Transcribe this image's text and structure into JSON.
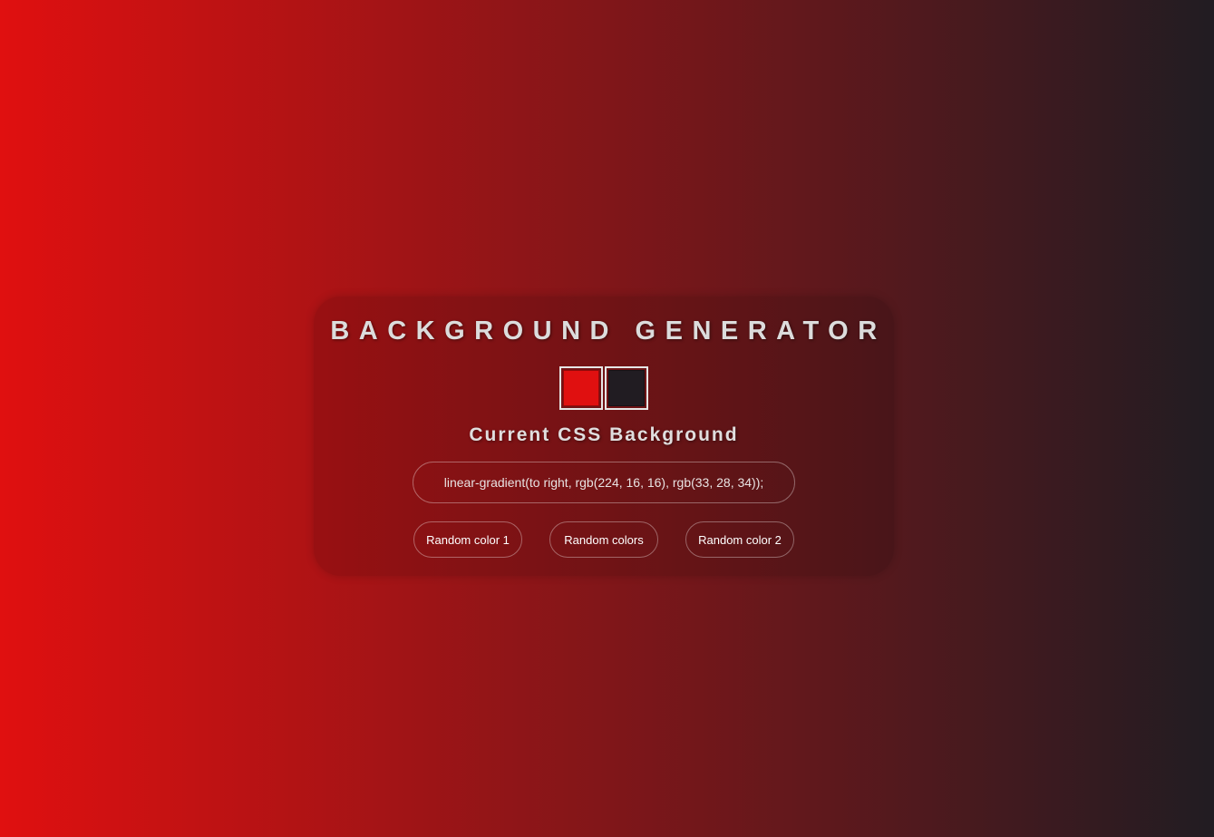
{
  "app": {
    "title": "BACKGROUND GENERATOR"
  },
  "colors": {
    "color1": "#e01010",
    "color2": "#211c22"
  },
  "current": {
    "label": "Current CSS Background",
    "value": "linear-gradient(to right, rgb(224, 16, 16), rgb(33, 28, 34));"
  },
  "buttons": {
    "random1": "Random color 1",
    "random_both": "Random colors",
    "random2": "Random color 2"
  }
}
